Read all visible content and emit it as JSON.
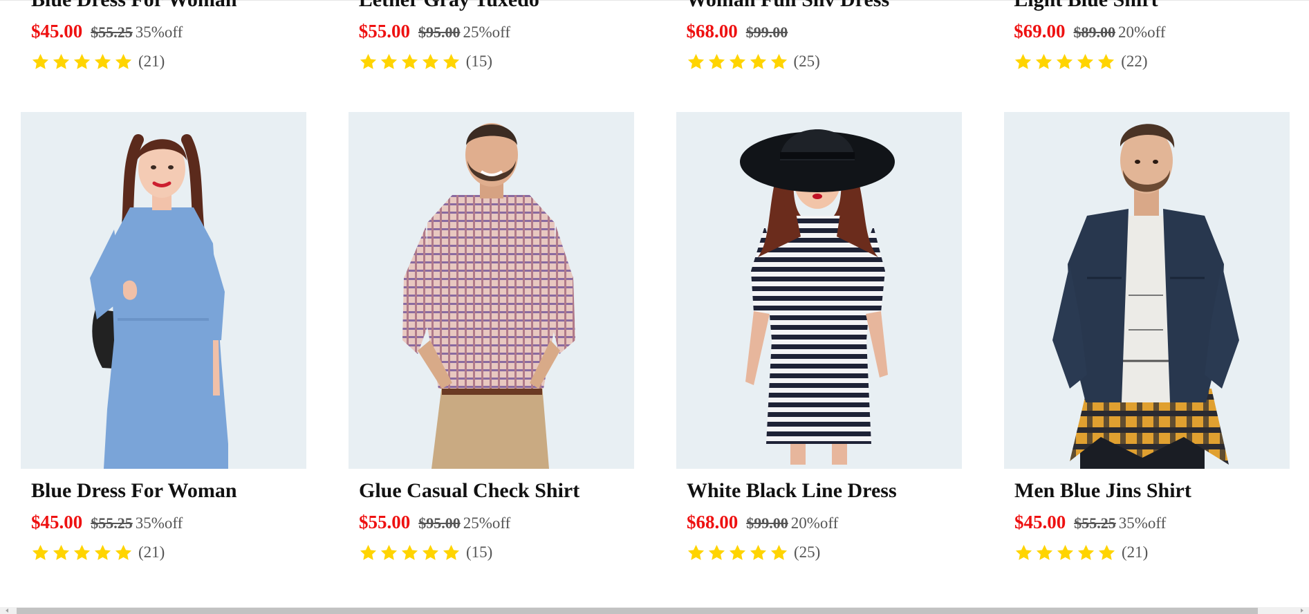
{
  "colors": {
    "price": "#ee1111",
    "star": "#ffd400",
    "image_bg": "#e8eff3",
    "muted_text": "#555555"
  },
  "top_row": [
    {
      "name": "Blue Dress For Woman",
      "price": "$45.00",
      "old_price": "$55.25",
      "discount": "35%off",
      "rating_count": "(21)"
    },
    {
      "name": "Lether Gray Tuxedo",
      "price": "$55.00",
      "old_price": "$95.00",
      "discount": "25%off",
      "rating_count": "(15)"
    },
    {
      "name": "Woman Full Sliv Dress",
      "price": "$68.00",
      "old_price": "$99.00",
      "discount": "",
      "rating_count": "(25)"
    },
    {
      "name": "Light Blue Shirt",
      "price": "$69.00",
      "old_price": "$89.00",
      "discount": "20%off",
      "rating_count": "(22)"
    }
  ],
  "products": [
    {
      "name": "Blue Dress For Woman",
      "price": "$45.00",
      "old_price": "$55.25",
      "discount": "35%off",
      "rating_count": "(21)",
      "image_icon": "woman-blue-dress-photo"
    },
    {
      "name": "Glue Casual Check Shirt",
      "price": "$55.00",
      "old_price": "$95.00",
      "discount": "25%off",
      "rating_count": "(15)",
      "image_icon": "man-check-shirt-photo"
    },
    {
      "name": "White Black Line Dress",
      "price": "$68.00",
      "old_price": "$99.00",
      "discount": "20%off",
      "rating_count": "(25)",
      "image_icon": "woman-striped-dress-photo"
    },
    {
      "name": "Men Blue Jins Shirt",
      "price": "$45.00",
      "old_price": "$55.25",
      "discount": "35%off",
      "rating_count": "(21)",
      "image_icon": "man-denim-jacket-photo"
    }
  ]
}
